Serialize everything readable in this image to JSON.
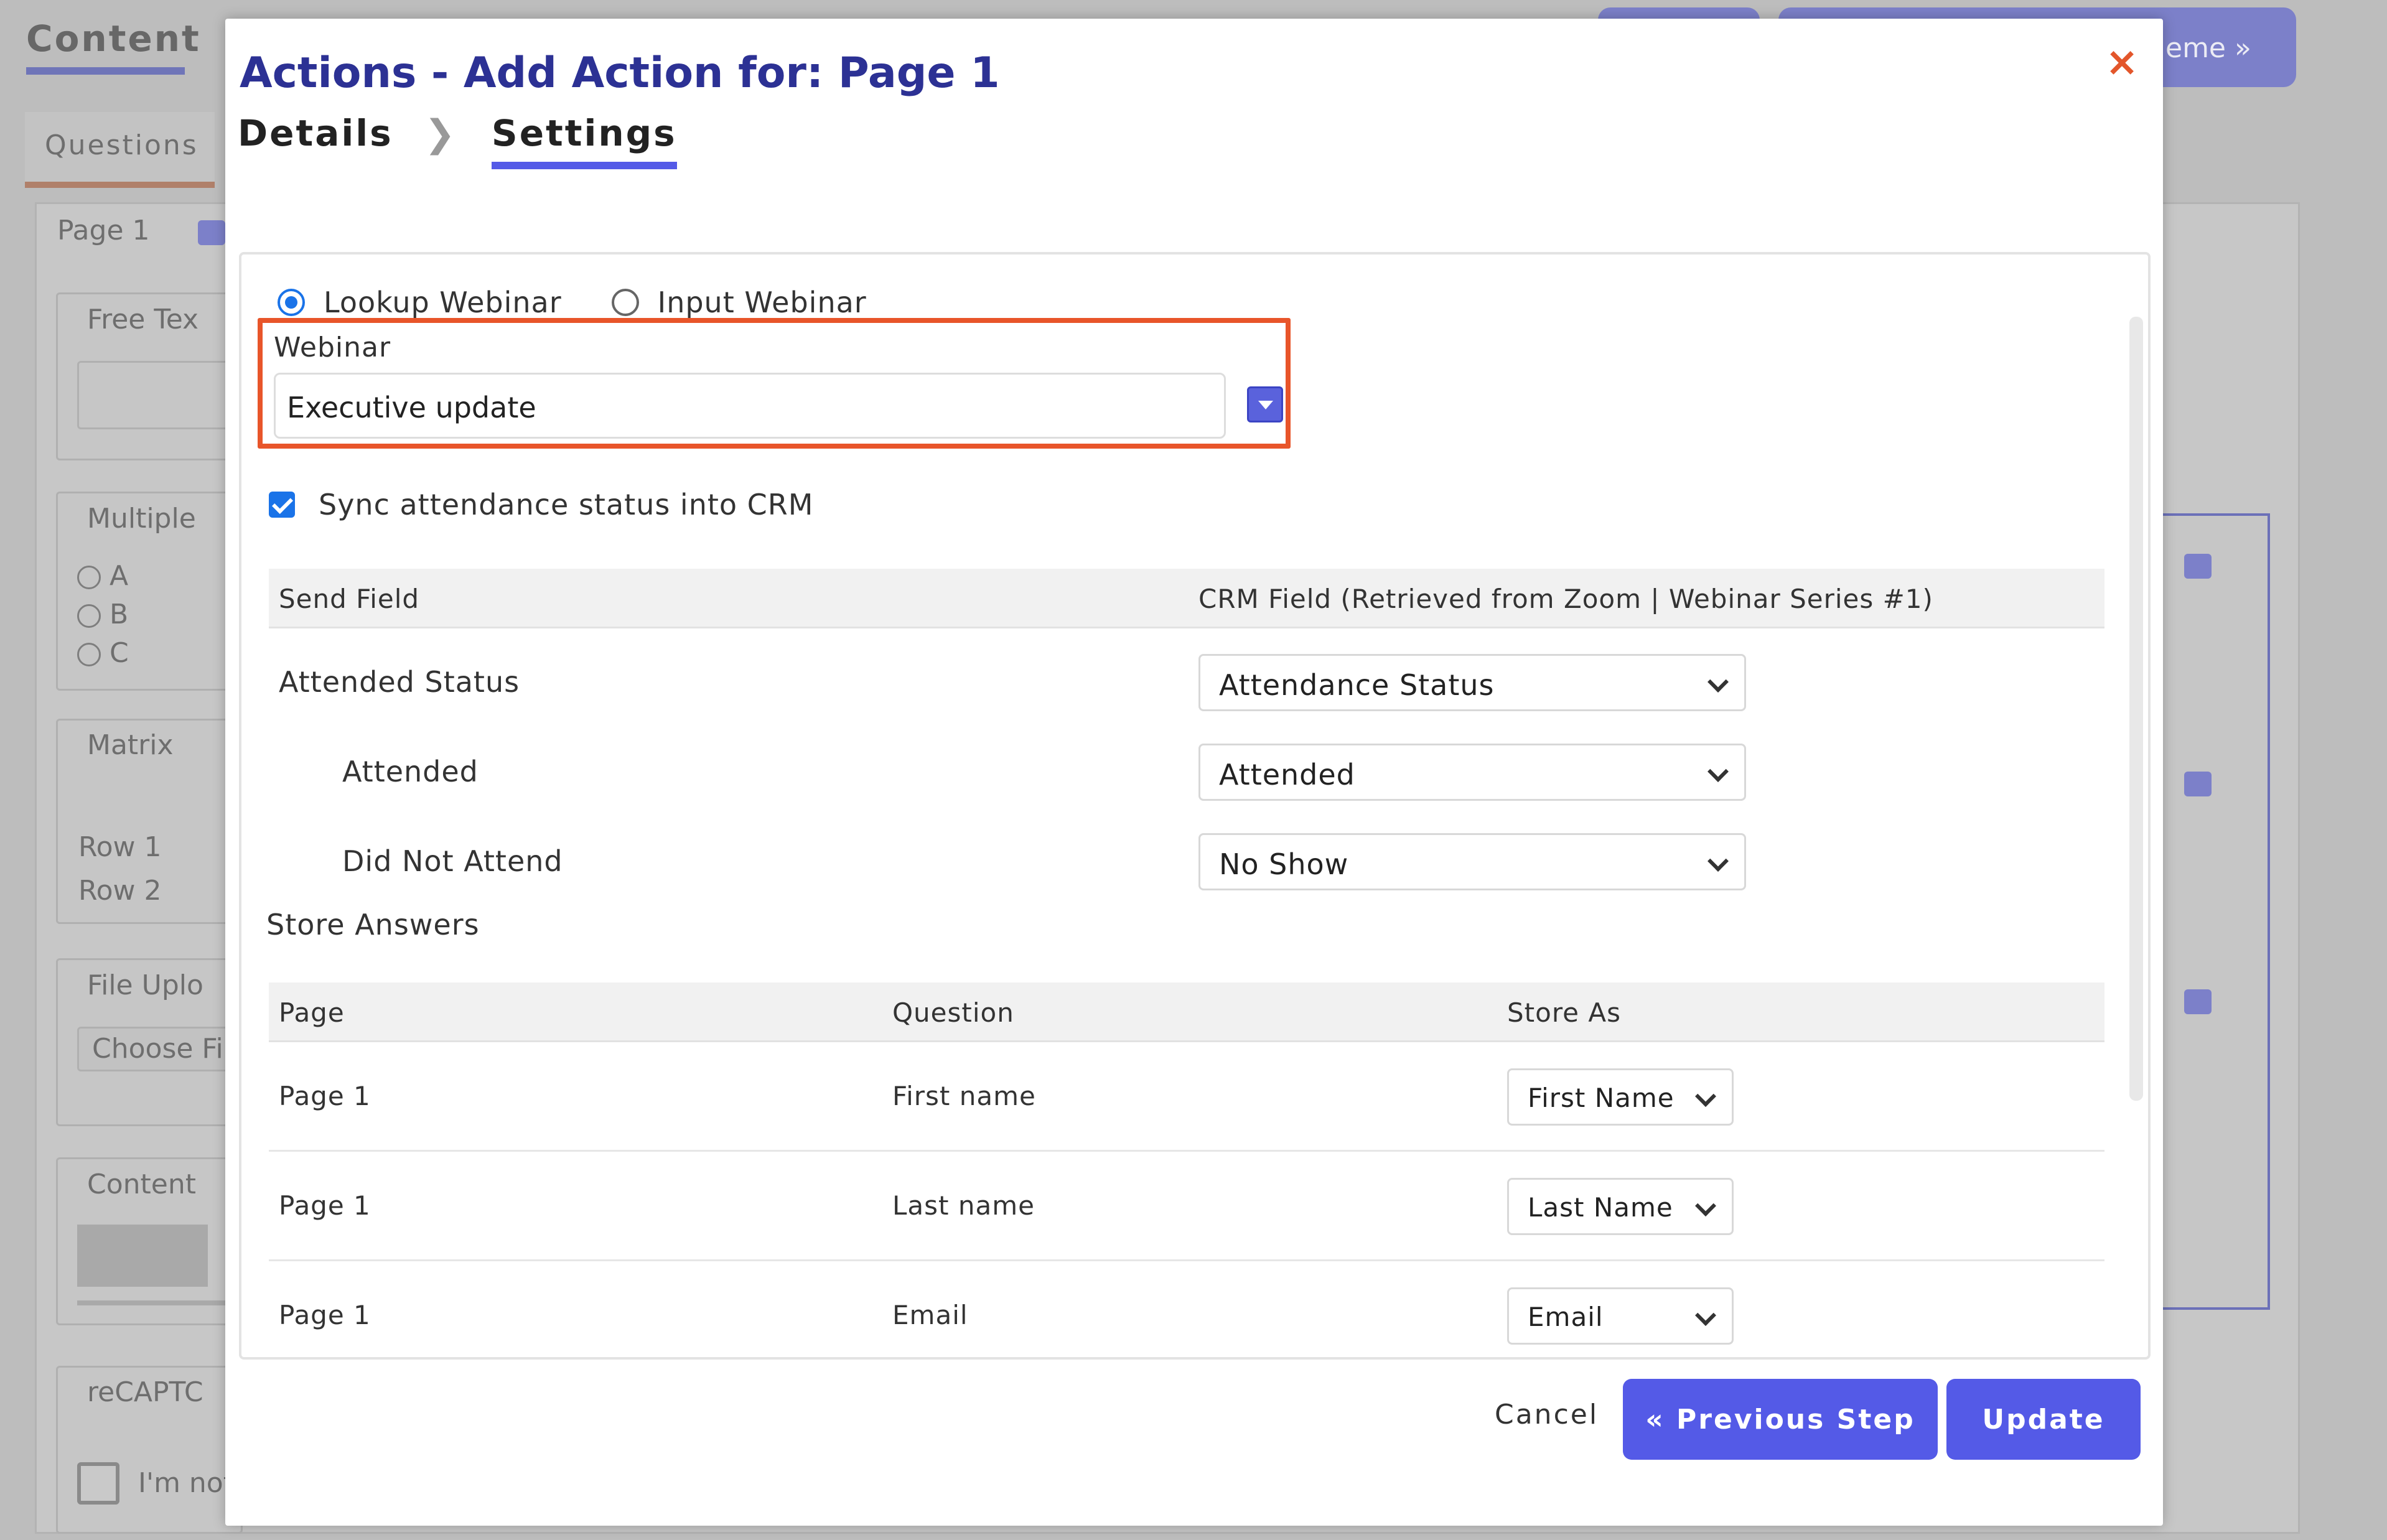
{
  "background": {
    "content_tab": "Content",
    "questions_tab": "Questions",
    "page_label": "Page 1",
    "widgets": [
      {
        "label": "Free Tex"
      },
      {
        "label": "Multiple"
      },
      {
        "label": "Matrix"
      },
      {
        "label": "File Uplo"
      },
      {
        "label": "Content"
      },
      {
        "label": "reCAPTC"
      }
    ],
    "options": [
      "A",
      "B",
      "C"
    ],
    "rows": [
      "Row 1",
      "Row 2"
    ],
    "choose_file": "Choose Fi",
    "captcha_text": "I'm not",
    "theme_button": "eme »"
  },
  "modal": {
    "title": "Actions - Add Action for: Page 1",
    "close": "×",
    "steps": [
      "Details",
      "Settings"
    ],
    "radio_options": [
      "Lookup Webinar",
      "Input Webinar"
    ],
    "webinar_label": "Webinar",
    "webinar_value": "Executive update",
    "sync_label": "Sync attendance status into CRM",
    "mapping_header": {
      "send": "Send Field",
      "crm": "CRM Field (Retrieved from Zoom | Webinar Series #1)"
    },
    "mapping_rows": [
      {
        "label": "Attended Status",
        "value": "Attendance Status"
      },
      {
        "label": "Attended",
        "value": "Attended"
      },
      {
        "label": "Did Not Attend",
        "value": "No Show"
      }
    ],
    "store_title": "Store Answers",
    "store_header": {
      "page": "Page",
      "question": "Question",
      "store_as": "Store As"
    },
    "store_rows": [
      {
        "page": "Page 1",
        "question": "First name",
        "store_as": "First Name"
      },
      {
        "page": "Page 1",
        "question": "Last name",
        "store_as": "Last Name"
      },
      {
        "page": "Page 1",
        "question": "Email",
        "store_as": "Email"
      }
    ],
    "footer": {
      "cancel": "Cancel",
      "previous": "« Previous Step",
      "update": "Update"
    }
  }
}
